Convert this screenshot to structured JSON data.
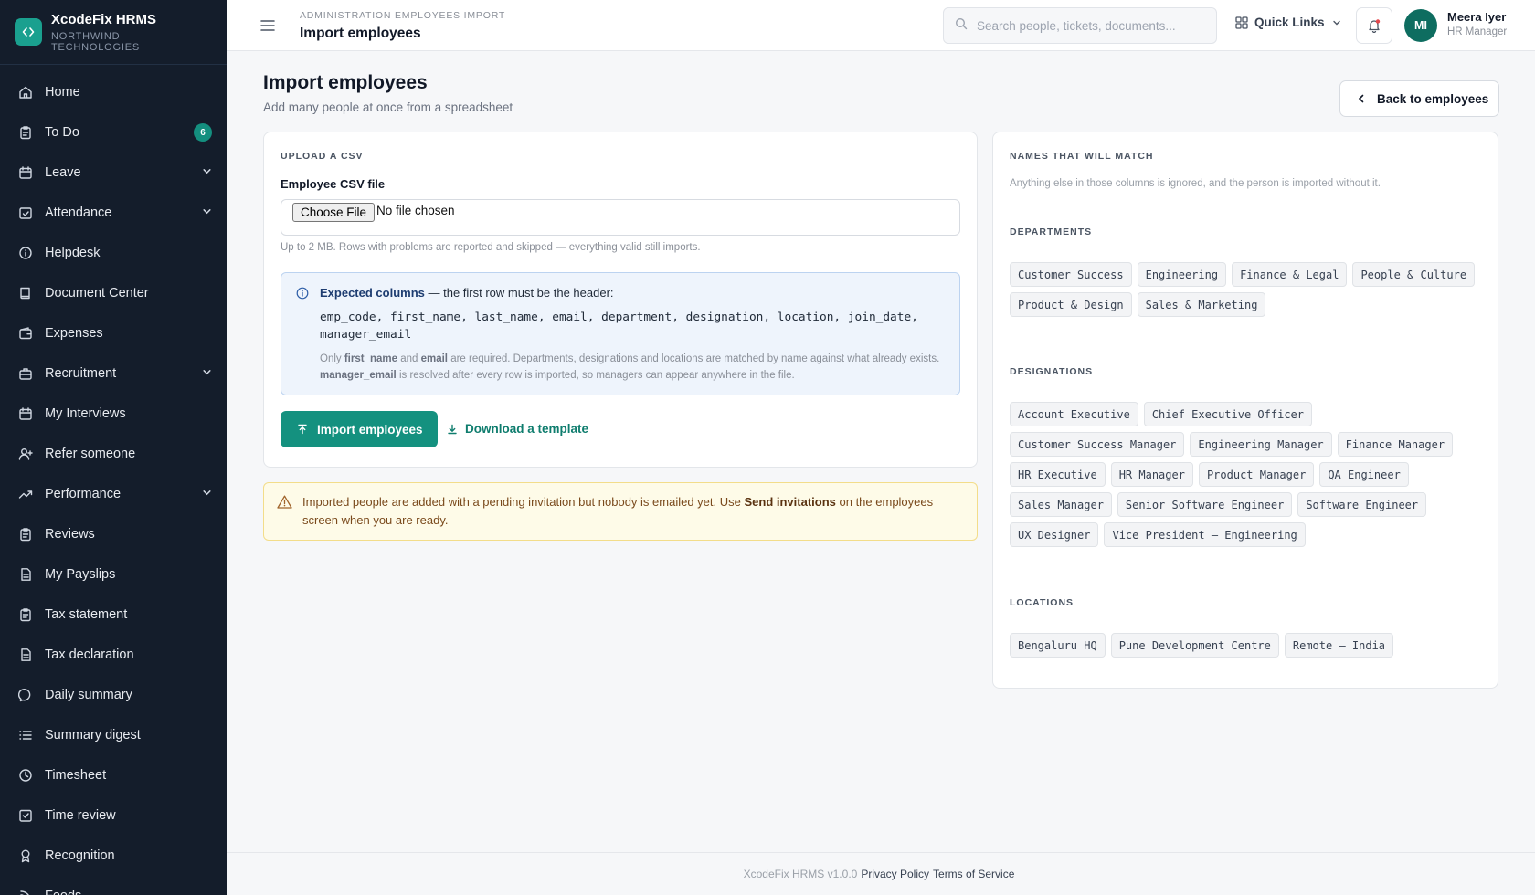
{
  "app": {
    "name": "XcodeFix HRMS",
    "org": "NORTHWIND TECHNOLOGIES"
  },
  "sidebar": {
    "items": [
      {
        "label": "Home",
        "icon": "home-icon"
      },
      {
        "label": "To Do",
        "icon": "clipboard-icon",
        "badge": "6"
      },
      {
        "label": "Leave",
        "icon": "calendar-icon",
        "expandable": true
      },
      {
        "label": "Attendance",
        "icon": "check-calendar-icon",
        "expandable": true
      },
      {
        "label": "Helpdesk",
        "icon": "info-circle-icon"
      },
      {
        "label": "Document Center",
        "icon": "book-icon"
      },
      {
        "label": "Expenses",
        "icon": "wallet-icon"
      },
      {
        "label": "Recruitment",
        "icon": "briefcase-icon",
        "expandable": true
      },
      {
        "label": "My Interviews",
        "icon": "calendar-icon"
      },
      {
        "label": "Refer someone",
        "icon": "user-plus-icon"
      },
      {
        "label": "Performance",
        "icon": "trend-icon",
        "expandable": true
      },
      {
        "label": "Reviews",
        "icon": "clipboard-icon"
      },
      {
        "label": "My Payslips",
        "icon": "file-icon"
      },
      {
        "label": "Tax statement",
        "icon": "clipboard-icon"
      },
      {
        "label": "Tax declaration",
        "icon": "file-icon"
      },
      {
        "label": "Daily summary",
        "icon": "chat-icon"
      },
      {
        "label": "Summary digest",
        "icon": "list-icon"
      },
      {
        "label": "Timesheet",
        "icon": "clock-icon"
      },
      {
        "label": "Time review",
        "icon": "check-square-icon"
      },
      {
        "label": "Recognition",
        "icon": "award-icon"
      },
      {
        "label": "Feeds",
        "icon": "feed-icon"
      }
    ]
  },
  "topbar": {
    "breadcrumb": "ADMINISTRATION EMPLOYEES IMPORT",
    "title": "Import employees",
    "search_placeholder": "Search people, tickets, documents...",
    "quick_links": "Quick Links",
    "user": {
      "initials": "MI",
      "name": "Meera Iyer",
      "role": "HR Manager"
    }
  },
  "page": {
    "title": "Import employees",
    "subtitle": "Add many people at once from a spreadsheet",
    "back_label": "Back to employees"
  },
  "upload": {
    "section": "UPLOAD A CSV",
    "field_label": "Employee CSV file",
    "choose_label": "Choose File",
    "no_file": "No file chosen",
    "hint": "Up to 2 MB. Rows with problems are reported and skipped — everything valid still imports.",
    "expected_title": "Expected columns",
    "expected_rest": " — the first row must be the header:",
    "columns_line1": "emp_code, first_name, last_name, email, department, designation, location, join_date,",
    "columns_line2": "manager_email",
    "note_a": "Only ",
    "note_b": "first_name",
    "note_c": " and ",
    "note_d": "email",
    "note_e": " are required. Departments, designations and locations are matched by name against what already exists. ",
    "note_f": "manager_email",
    "note_g": " is resolved after every row is imported, so managers can appear anywhere in the file.",
    "import_label": "Import employees",
    "template_label": "Download a template"
  },
  "warning": {
    "text_a": "Imported people are added with a pending invitation but nobody is emailed yet. Use ",
    "text_b": "Send invitations",
    "text_c": " on the employees screen when you are ready."
  },
  "matches": {
    "section": "NAMES THAT WILL MATCH",
    "note": "Anything else in those columns is ignored, and the person is imported without it.",
    "departments_label": "DEPARTMENTS",
    "departments": [
      "Customer Success",
      "Engineering",
      "Finance & Legal",
      "People & Culture",
      "Product & Design",
      "Sales & Marketing"
    ],
    "designations_label": "DESIGNATIONS",
    "designations": [
      "Account Executive",
      "Chief Executive Officer",
      "Customer Success Manager",
      "Engineering Manager",
      "Finance Manager",
      "HR Executive",
      "HR Manager",
      "Product Manager",
      "QA Engineer",
      "Sales Manager",
      "Senior Software Engineer",
      "Software Engineer",
      "UX Designer",
      "Vice President — Engineering"
    ],
    "locations_label": "LOCATIONS",
    "locations": [
      "Bengaluru HQ",
      "Pune Development Centre",
      "Remote — India"
    ]
  },
  "footer": {
    "version": "XcodeFix HRMS v1.0.0",
    "privacy": "Privacy Policy",
    "terms": "Terms of Service"
  },
  "colors": {
    "accent": "#14917f",
    "sidebar": "#141d2b",
    "warning_bg": "#fefbe8",
    "info_bg": "#eef4fc"
  }
}
